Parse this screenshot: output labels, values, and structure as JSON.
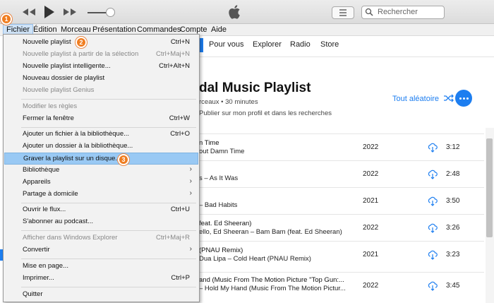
{
  "search": {
    "placeholder": "Rechercher"
  },
  "menubar": [
    "Fichier",
    "Édition",
    "Morceau",
    "Présentation",
    "Commandes",
    "Compte",
    "Aide"
  ],
  "nav": {
    "tabs": [
      "Pour vous",
      "Explorer",
      "Radio",
      "Store"
    ]
  },
  "playlist": {
    "title": "dal Music Playlist",
    "subtitle": "rceaux • 30 minutes",
    "publish": "Publier sur mon profil et dans les recherches",
    "shuffle_label": "Tout aléatoire"
  },
  "tracks": [
    {
      "title": "n Time",
      "artist": "out Damn Time",
      "year": "2022",
      "duration": "3:12"
    },
    {
      "title": "",
      "artist": "s – As It Was",
      "year": "2022",
      "duration": "2:48"
    },
    {
      "title": "",
      "artist": "– Bad Habits",
      "year": "2021",
      "duration": "3:50"
    },
    {
      "title": "feat. Ed Sheeran)",
      "artist": "ello, Ed Sheeran – Bam Bam (feat. Ed Sheeran)",
      "year": "2022",
      "duration": "3:26"
    },
    {
      "title": "(PNAU Remix)",
      "artist": "Dua Lipa – Cold Heart (PNAU Remix)",
      "year": "2021",
      "duration": "3:23"
    },
    {
      "title": "and (Music From The Motion Picture \"Top Gun:...",
      "artist": "– Hold My Hand (Music From The Motion Pictur...",
      "year": "2022",
      "duration": "3:45"
    }
  ],
  "menu": {
    "items": [
      {
        "label": "Nouvelle playlist",
        "shortcut": "Ctrl+N"
      },
      {
        "label": "Nouvelle playlist à partir de la sélection",
        "shortcut": "Ctrl+Maj+N"
      },
      {
        "label": "Nouvelle playlist intelligente...",
        "shortcut": "Ctrl+Alt+N"
      },
      {
        "label": "Nouveau dossier de playlist",
        "shortcut": ""
      },
      {
        "label": "Nouvelle playlist Genius",
        "shortcut": ""
      },
      {
        "label": "Modifier les règles",
        "shortcut": ""
      },
      {
        "label": "Fermer la fenêtre",
        "shortcut": "Ctrl+W"
      },
      {
        "label": "Ajouter un fichier à la bibliothèque...",
        "shortcut": "Ctrl+O"
      },
      {
        "label": "Ajouter un dossier à la bibliothèque...",
        "shortcut": ""
      },
      {
        "label": "Graver la playlist sur un disque...",
        "shortcut": ""
      },
      {
        "label": "Bibliothèque",
        "shortcut": ""
      },
      {
        "label": "Appareils",
        "shortcut": ""
      },
      {
        "label": "Partage à domicile",
        "shortcut": ""
      },
      {
        "label": "Ouvrir le flux...",
        "shortcut": "Ctrl+U"
      },
      {
        "label": "S'abonner au podcast...",
        "shortcut": ""
      },
      {
        "label": "Afficher dans Windows Explorer",
        "shortcut": "Ctrl+Maj+R"
      },
      {
        "label": "Convertir",
        "shortcut": ""
      },
      {
        "label": "Mise en page...",
        "shortcut": ""
      },
      {
        "label": "Imprimer...",
        "shortcut": "Ctrl+P"
      },
      {
        "label": "Quitter",
        "shortcut": ""
      }
    ]
  },
  "badges": [
    "1",
    "2",
    "3"
  ],
  "colors": {
    "accent": "#1d7ef0",
    "badge": "#f07d20",
    "highlight": "#99c9f4"
  }
}
